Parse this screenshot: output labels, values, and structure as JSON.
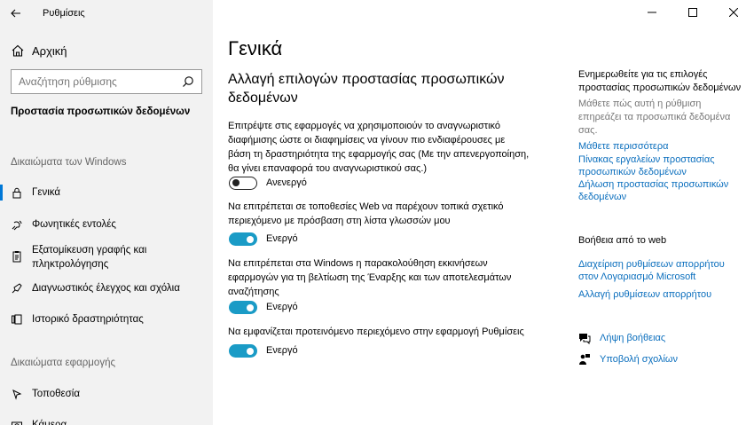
{
  "window": {
    "title": "Ρυθμίσεις"
  },
  "sidebar": {
    "home_label": "Αρχική",
    "search_placeholder": "Αναζήτηση ρύθμισης",
    "section_title": "Προστασία προσωπικών δεδομένων",
    "group1_label": "Δικαιώματα των Windows",
    "group1_items": [
      {
        "label": "Γενικά",
        "icon": "lock-icon",
        "selected": true
      },
      {
        "label": "Φωνητικές εντολές",
        "icon": "voice-icon"
      },
      {
        "label": "Εξατομίκευση γραφής και πληκτρολόγησης",
        "icon": "clipboard-icon"
      },
      {
        "label": "Διαγνωστικός έλεγχος και σχόλια",
        "icon": "feedback-icon"
      },
      {
        "label": "Ιστορικό δραστηριότητας",
        "icon": "history-icon"
      }
    ],
    "group2_label": "Δικαιώματα εφαρμογής",
    "group2_items": [
      {
        "label": "Τοποθεσία",
        "icon": "location-icon"
      },
      {
        "label": "Κάμερα",
        "icon": "camera-icon"
      }
    ]
  },
  "main": {
    "page_title": "Γενικά",
    "sub_title": "Αλλαγή επιλογών προστασίας προσωπικών δεδομένων",
    "settings": [
      {
        "text": "Επιτρέψτε στις εφαρμογές να χρησιμοποιούν το αναγνωριστικό διαφήμισης ώστε οι διαφημίσεις να γίνουν πιο ενδιαφέρουσες με βάση τη δραστηριότητα της εφαρμογής σας (Με την απενεργοποίηση, θα γίνει επαναφορά του αναγνωριστικού σας.)",
        "state": "Ανενεργό",
        "on": false
      },
      {
        "text": "Να επιτρέπεται σε τοποθεσίες Web να παρέχουν τοπικά σχετικό περιεχόμενο με πρόσβαση στη λίστα γλωσσών μου",
        "state": "Ενεργό",
        "on": true
      },
      {
        "text": "Να επιτρέπεται στα Windows η παρακολούθηση εκκινήσεων εφαρμογών για τη βελτίωση της Έναρξης και των αποτελεσμάτων αναζήτησης",
        "state": "Ενεργό",
        "on": true
      },
      {
        "text": "Να εμφανίζεται προτεινόμενο περιεχόμενο στην εφαρμογή Ρυθμίσεις",
        "state": "Ενεργό",
        "on": true
      }
    ]
  },
  "right": {
    "info_title": "Ενημερωθείτε για τις επιλογές προστασίας προσωπικών δεδομένων",
    "info_text": "Μάθετε πώς αυτή η ρύθμιση επηρεάζει τα προσωπικά δεδομένα σας.",
    "links": [
      "Μάθετε περισσότερα",
      "Πίνακας εργαλείων προστασίας προσωπικών δεδομένων",
      "Δήλωση προστασίας προσωπικών δεδομένων"
    ],
    "web_help_title": "Βοήθεια από το web",
    "web_links": [
      "Διαχείριση ρυθμίσεων απορρήτου στον Λογαριασμό Microsoft",
      "Αλλαγή ρυθμίσεων απορρήτου"
    ],
    "get_help": "Λήψη βοήθειας",
    "give_feedback": "Υποβολή σχολίων"
  },
  "colors": {
    "accent": "#0078d7",
    "toggle_on": "#1a9bc6",
    "link": "#0a6ebd",
    "sidebar_bg": "#f2f2f2"
  }
}
